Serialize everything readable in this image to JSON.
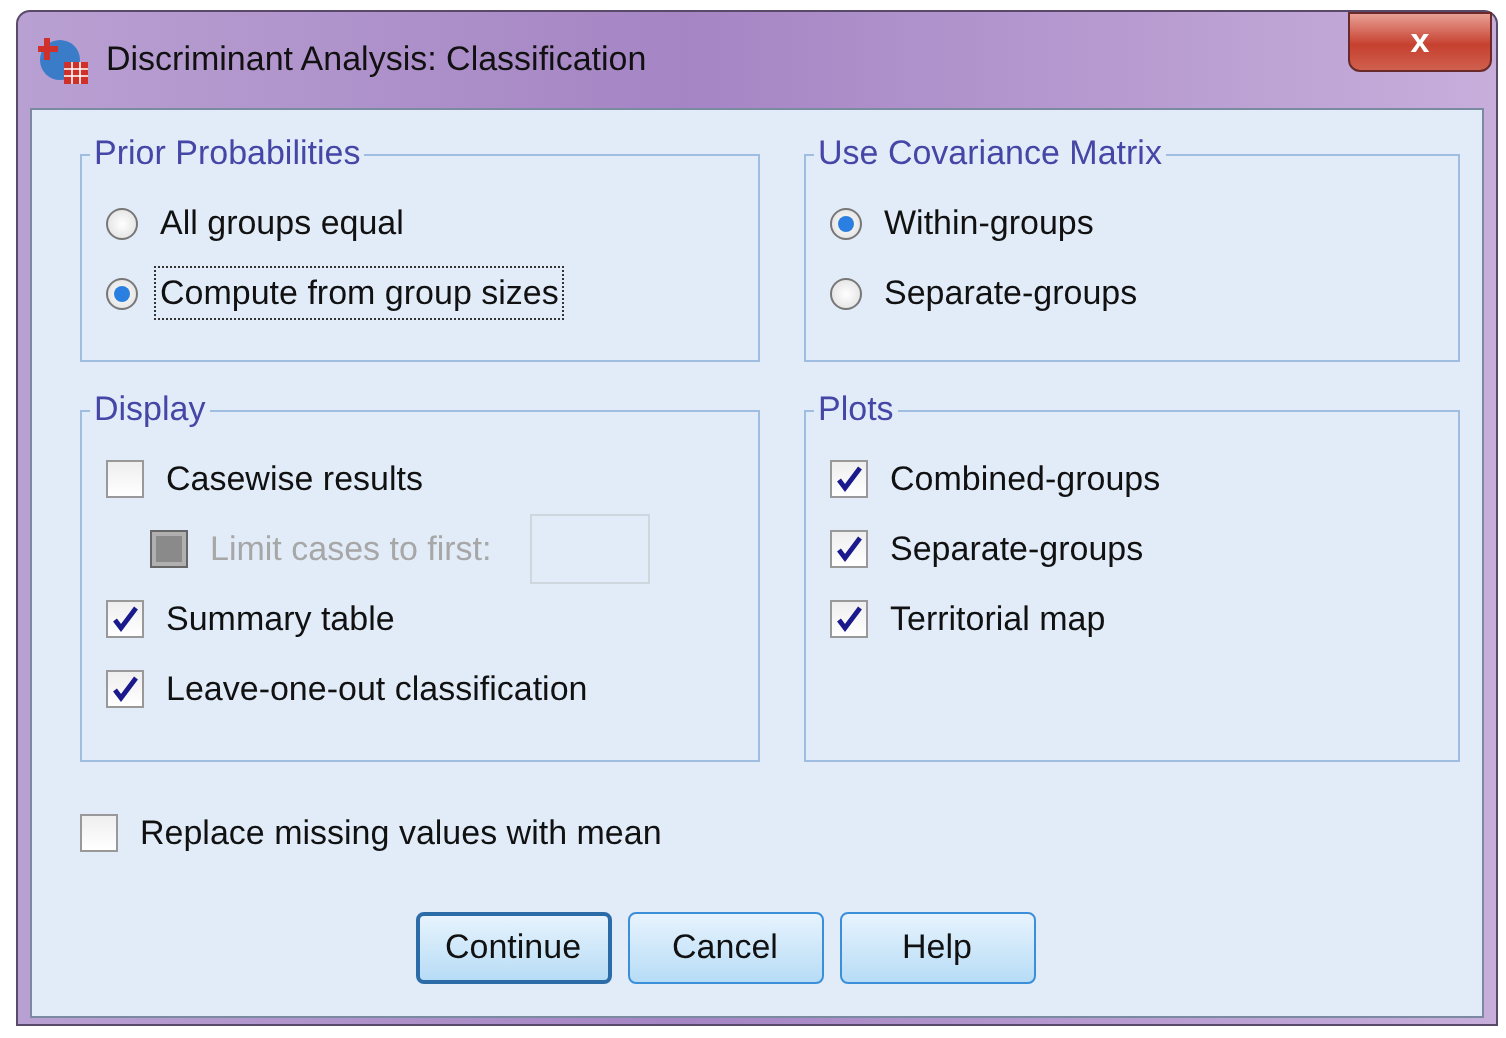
{
  "window": {
    "title": "Discriminant Analysis: Classification",
    "close": "x"
  },
  "groups": [
    {
      "title": "Prior Probabilities",
      "items": [
        {
          "kind": "radio",
          "label": "All groups equal",
          "selected": false,
          "focused": false
        },
        {
          "kind": "radio",
          "label": "Compute from group sizes",
          "selected": true,
          "focused": true
        }
      ]
    },
    {
      "title": "Use Covariance Matrix",
      "items": [
        {
          "kind": "radio",
          "label": "Within-groups",
          "selected": true,
          "focused": false
        },
        {
          "kind": "radio",
          "label": "Separate-groups",
          "selected": false,
          "focused": false
        }
      ]
    },
    {
      "title": "Display",
      "items": [
        {
          "kind": "checkbox",
          "label": "Casewise results",
          "checked": false,
          "disabled": false
        },
        {
          "kind": "sub-checkbox-field",
          "label": "Limit cases to first:",
          "checked": false,
          "disabled": true
        },
        {
          "kind": "checkbox",
          "label": "Summary table",
          "checked": true,
          "disabled": false
        },
        {
          "kind": "checkbox",
          "label": "Leave-one-out classification",
          "checked": true,
          "disabled": false
        }
      ]
    },
    {
      "title": "Plots",
      "items": [
        {
          "kind": "checkbox",
          "label": "Combined-groups",
          "checked": true,
          "disabled": false
        },
        {
          "kind": "checkbox",
          "label": "Separate-groups",
          "checked": true,
          "disabled": false
        },
        {
          "kind": "checkbox",
          "label": "Territorial map",
          "checked": true,
          "disabled": false
        }
      ]
    }
  ],
  "replace_missing": {
    "label": "Replace missing values with mean",
    "checked": false
  },
  "buttons": [
    {
      "label": "Continue",
      "default": true
    },
    {
      "label": "Cancel",
      "default": false
    },
    {
      "label": "Help",
      "default": false
    }
  ]
}
